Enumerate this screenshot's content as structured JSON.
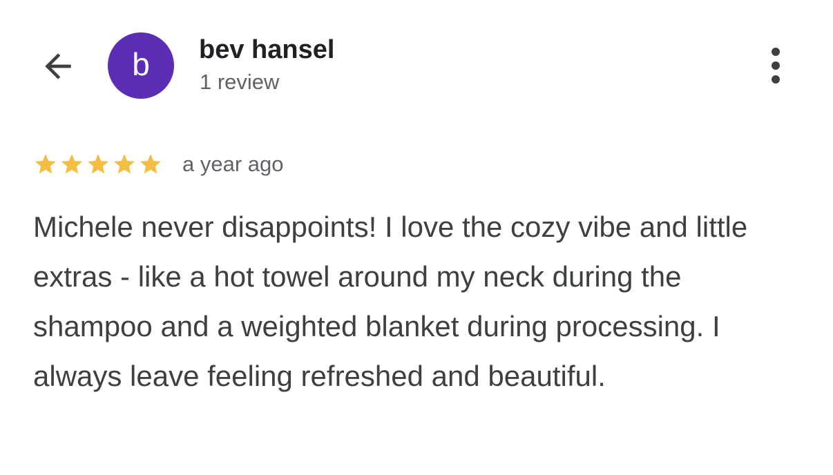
{
  "header": {
    "back_icon": "arrow-back-icon",
    "avatar": {
      "letter": "b",
      "color": "#5B2DB5"
    },
    "user_name": "bev hansel",
    "review_count": "1 review",
    "more_icon": "more-vert-icon"
  },
  "review": {
    "rating": 5,
    "rating_max": 5,
    "star_color": "#F4BE42",
    "date": "a year ago",
    "text": "Michele never disappoints! I love the cozy vibe and little extras - like a hot towel around my neck during the shampoo and a weighted blanket during processing. I always leave feeling refreshed and beautiful."
  }
}
